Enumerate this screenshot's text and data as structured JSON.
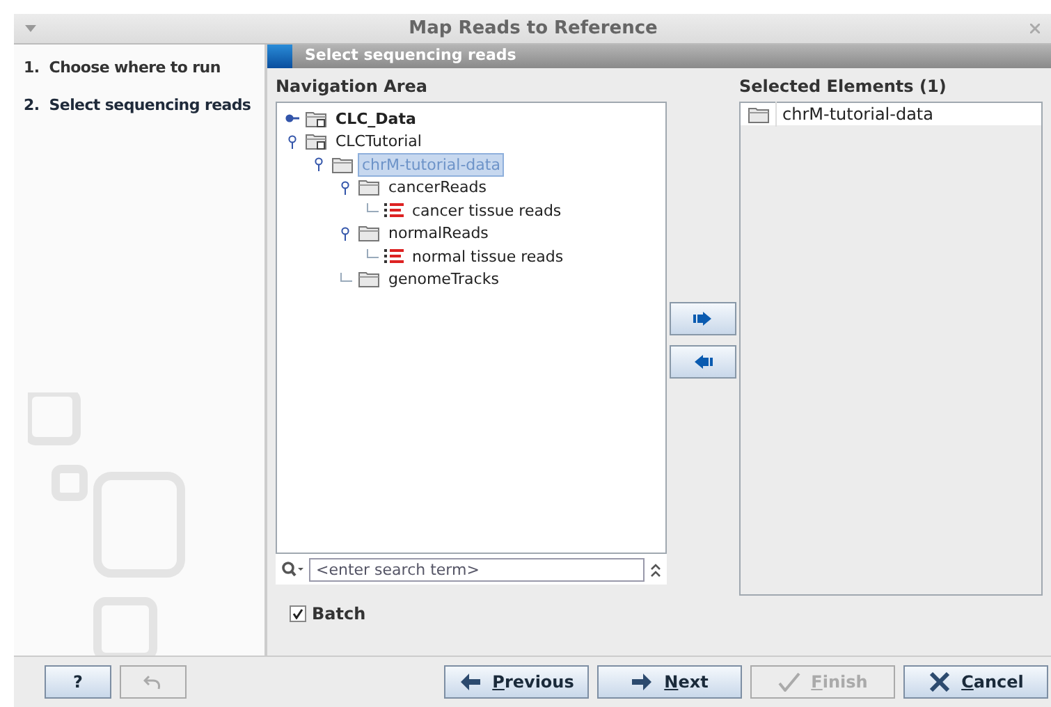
{
  "window": {
    "title": "Map Reads to Reference"
  },
  "steps": [
    {
      "label": "1.  Choose where to run",
      "selected": false
    },
    {
      "label": "2.  Select sequencing reads",
      "selected": true
    }
  ],
  "section_title": "Select sequencing reads",
  "navigation": {
    "title": "Navigation Area",
    "tree": [
      {
        "label": "CLC_Data",
        "kind": "location",
        "bold": true,
        "expanded": false,
        "selected": false
      },
      {
        "label": "CLCTutorial",
        "kind": "location",
        "bold": false,
        "expanded": true,
        "selected": false,
        "children": [
          {
            "label": "chrM-tutorial-data",
            "kind": "folder",
            "bold": false,
            "expanded": true,
            "selected": true,
            "children": [
              {
                "label": "cancerReads",
                "kind": "folder",
                "bold": false,
                "expanded": true,
                "selected": false,
                "children": [
                  {
                    "label": "cancer tissue reads",
                    "kind": "reads",
                    "bold": false,
                    "selected": false
                  }
                ]
              },
              {
                "label": "normalReads",
                "kind": "folder",
                "bold": false,
                "expanded": true,
                "selected": false,
                "children": [
                  {
                    "label": "normal tissue reads",
                    "kind": "reads",
                    "bold": false,
                    "selected": false
                  }
                ]
              },
              {
                "label": "genomeTracks",
                "kind": "folder",
                "bold": false,
                "selected": false
              }
            ]
          }
        ]
      }
    ],
    "search": {
      "placeholder": "<enter search term>"
    }
  },
  "selected_elements": {
    "title": "Selected Elements (1)",
    "items": [
      "chrM-tutorial-data"
    ]
  },
  "batch": {
    "label": "Batch",
    "checked": true
  },
  "buttons": [
    {
      "label": "?",
      "kind": "help",
      "disabled": false
    },
    {
      "kind": "undo",
      "disabled": true
    },
    {
      "label": "Previous",
      "kind": "previous",
      "disabled": false
    },
    {
      "label": "Next",
      "kind": "next",
      "disabled": false
    },
    {
      "label": "Finish",
      "kind": "finish",
      "disabled": true
    },
    {
      "label": "Cancel",
      "kind": "cancel",
      "disabled": false
    }
  ]
}
